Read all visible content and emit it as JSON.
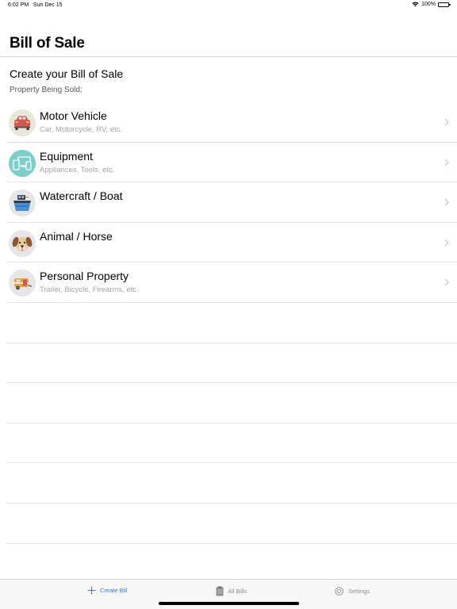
{
  "status_bar": {
    "time": "6:02 PM",
    "date": "Sun Dec 15",
    "battery": "100%",
    "wifi_icon": "wifi-icon",
    "battery_icon": "battery-icon"
  },
  "nav": {
    "title": "Bill of Sale"
  },
  "section": {
    "title": "Create your Bill of Sale",
    "subtitle": "Property Being Sold:"
  },
  "items": [
    {
      "title": "Motor Vehicle",
      "subtitle": "Car, Motorcycle, RV, etc.",
      "icon": "car-icon"
    },
    {
      "title": "Equipment",
      "subtitle": "Appliances, Tools, etc.",
      "icon": "devices-icon"
    },
    {
      "title": "Watercraft / Boat",
      "subtitle": "",
      "icon": "boat-icon"
    },
    {
      "title": "Animal / Horse",
      "subtitle": "",
      "icon": "dog-icon"
    },
    {
      "title": "Personal Property",
      "subtitle": "Trailer, Bicycle, Firearms, etc.",
      "icon": "trailer-icon"
    }
  ],
  "tabs": [
    {
      "label": "Create Bill",
      "icon": "plus-icon",
      "active": true
    },
    {
      "label": "All Bills",
      "icon": "clipboard-icon",
      "active": false
    },
    {
      "label": "Settings",
      "icon": "gear-icon",
      "active": false
    }
  ],
  "colors": {
    "accent": "#2a7de1",
    "separator": "#e4e4e6",
    "subtitle_text": "#a3a3a6",
    "equipment_icon_bg": "#7ccfc8"
  }
}
